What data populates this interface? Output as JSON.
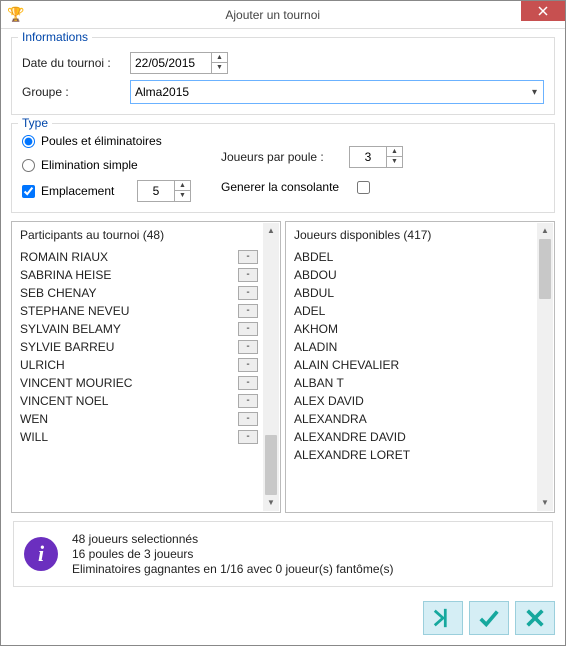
{
  "window": {
    "title": "Ajouter un tournoi"
  },
  "info_group": {
    "legend": "Informations",
    "date_label": "Date du tournoi :",
    "date_value": "22/05/2015",
    "group_label": "Groupe :",
    "group_value": "Alma2015"
  },
  "type_group": {
    "legend": "Type",
    "radio_poules": "Poules et éliminatoires",
    "radio_elim": "Elimination simple",
    "check_emplacement": "Emplacement",
    "emplacement_value": "5",
    "players_per_pool_label": "Joueurs par poule :",
    "players_per_pool_value": "3",
    "consolante_label": "Generer la consolante"
  },
  "participants": {
    "header": "Participants au tournoi (48)",
    "items": [
      "ROMAIN RIAUX",
      "SABRINA HEISE",
      "SEB CHENAY",
      "STEPHANE NEVEU",
      "SYLVAIN  BELAMY",
      "SYLVIE BARREU",
      "ULRICH",
      "VINCENT MOURIEC",
      "VINCENT NOEL",
      "WEN",
      "WILL"
    ]
  },
  "available": {
    "header": "Joueurs disponibles (417)",
    "items": [
      "ABDEL",
      "ABDOU",
      "ABDUL",
      "ADEL",
      "AKHOM",
      "ALADIN",
      "ALAIN CHEVALIER",
      "ALBAN T",
      "ALEX DAVID",
      "ALEXANDRA",
      "ALEXANDRE DAVID",
      "ALEXANDRE LORET"
    ]
  },
  "summary": {
    "line1": "48 joueurs selectionnés",
    "line2": "16 poules de 3 joueurs",
    "line3": "Eliminatoires gagnantes en 1/16 avec 0 joueur(s) fantôme(s)"
  }
}
